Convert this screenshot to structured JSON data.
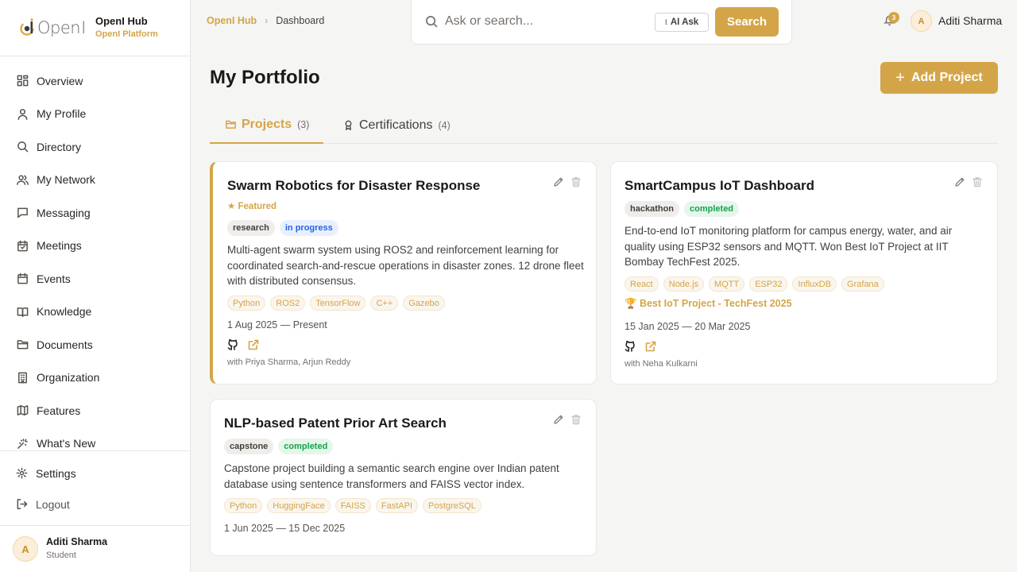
{
  "brand": {
    "logo_word": "Open",
    "title": "OpenI Hub",
    "subtitle": "OpenI Platform"
  },
  "nav": [
    {
      "label": "Overview",
      "icon": "grid-icon"
    },
    {
      "label": "My Profile",
      "icon": "user-icon"
    },
    {
      "label": "Directory",
      "icon": "search-icon"
    },
    {
      "label": "My Network",
      "icon": "users-icon"
    },
    {
      "label": "Messaging",
      "icon": "message-icon"
    },
    {
      "label": "Meetings",
      "icon": "calendar-check-icon"
    },
    {
      "label": "Events",
      "icon": "calendar-icon"
    },
    {
      "label": "Knowledge",
      "icon": "book-icon"
    },
    {
      "label": "Documents",
      "icon": "folder-icon"
    },
    {
      "label": "Organization",
      "icon": "building-icon"
    },
    {
      "label": "Features",
      "icon": "map-icon"
    },
    {
      "label": "What's New",
      "icon": "sparkle-icon"
    }
  ],
  "settings_label": "Settings",
  "logout_label": "Logout",
  "user": {
    "initial": "A",
    "name": "Aditi Sharma",
    "role": "Student"
  },
  "breadcrumb": {
    "root": "OpenI Hub",
    "current": "Dashboard"
  },
  "search": {
    "placeholder": "Ask or search...",
    "ai_label": "AI Ask",
    "button": "Search"
  },
  "notifications": {
    "count": "3"
  },
  "page": {
    "title": "My Portfolio",
    "add_label": "Add Project"
  },
  "tabs": [
    {
      "label": "Projects",
      "count": "(3)"
    },
    {
      "label": "Certifications",
      "count": "(4)"
    }
  ],
  "projects": [
    {
      "title": "Swarm Robotics for Disaster Response",
      "featured": "★ Featured",
      "type": "research",
      "status": "in progress",
      "description": "Multi-agent swarm system using ROS2 and reinforcement learning for coordinated search-and-rescue operations in disaster zones. 12 drone fleet with distributed consensus.",
      "tags": [
        "Python",
        "ROS2",
        "TensorFlow",
        "C++",
        "Gazebo"
      ],
      "dates": "1 Aug 2025 — Present",
      "collaborators": "with Priya Sharma, Arjun Reddy"
    },
    {
      "title": "SmartCampus IoT Dashboard",
      "type": "hackathon",
      "status": "completed",
      "description": "End-to-end IoT monitoring platform for campus energy, water, and air quality using ESP32 sensors and MQTT. Won Best IoT Project at IIT Bombay TechFest 2025.",
      "tags": [
        "React",
        "Node.js",
        "MQTT",
        "ESP32",
        "InfluxDB",
        "Grafana"
      ],
      "award": "🏆 Best IoT Project - TechFest 2025",
      "dates": "15 Jan 2025 — 20 Mar 2025",
      "collaborators": "with Neha Kulkarni"
    },
    {
      "title": "NLP-based Patent Prior Art Search",
      "type": "capstone",
      "status": "completed",
      "description": "Capstone project building a semantic search engine over Indian patent database using sentence transformers and FAISS vector index.",
      "tags": [
        "Python",
        "HuggingFace",
        "FAISS",
        "FastAPI",
        "PostgreSQL"
      ],
      "dates": "1 Jun 2025 — 15 Dec 2025"
    }
  ],
  "colors": {
    "accent": "#d4a548",
    "in_progress": "#2563eb",
    "completed": "#16a34a"
  }
}
